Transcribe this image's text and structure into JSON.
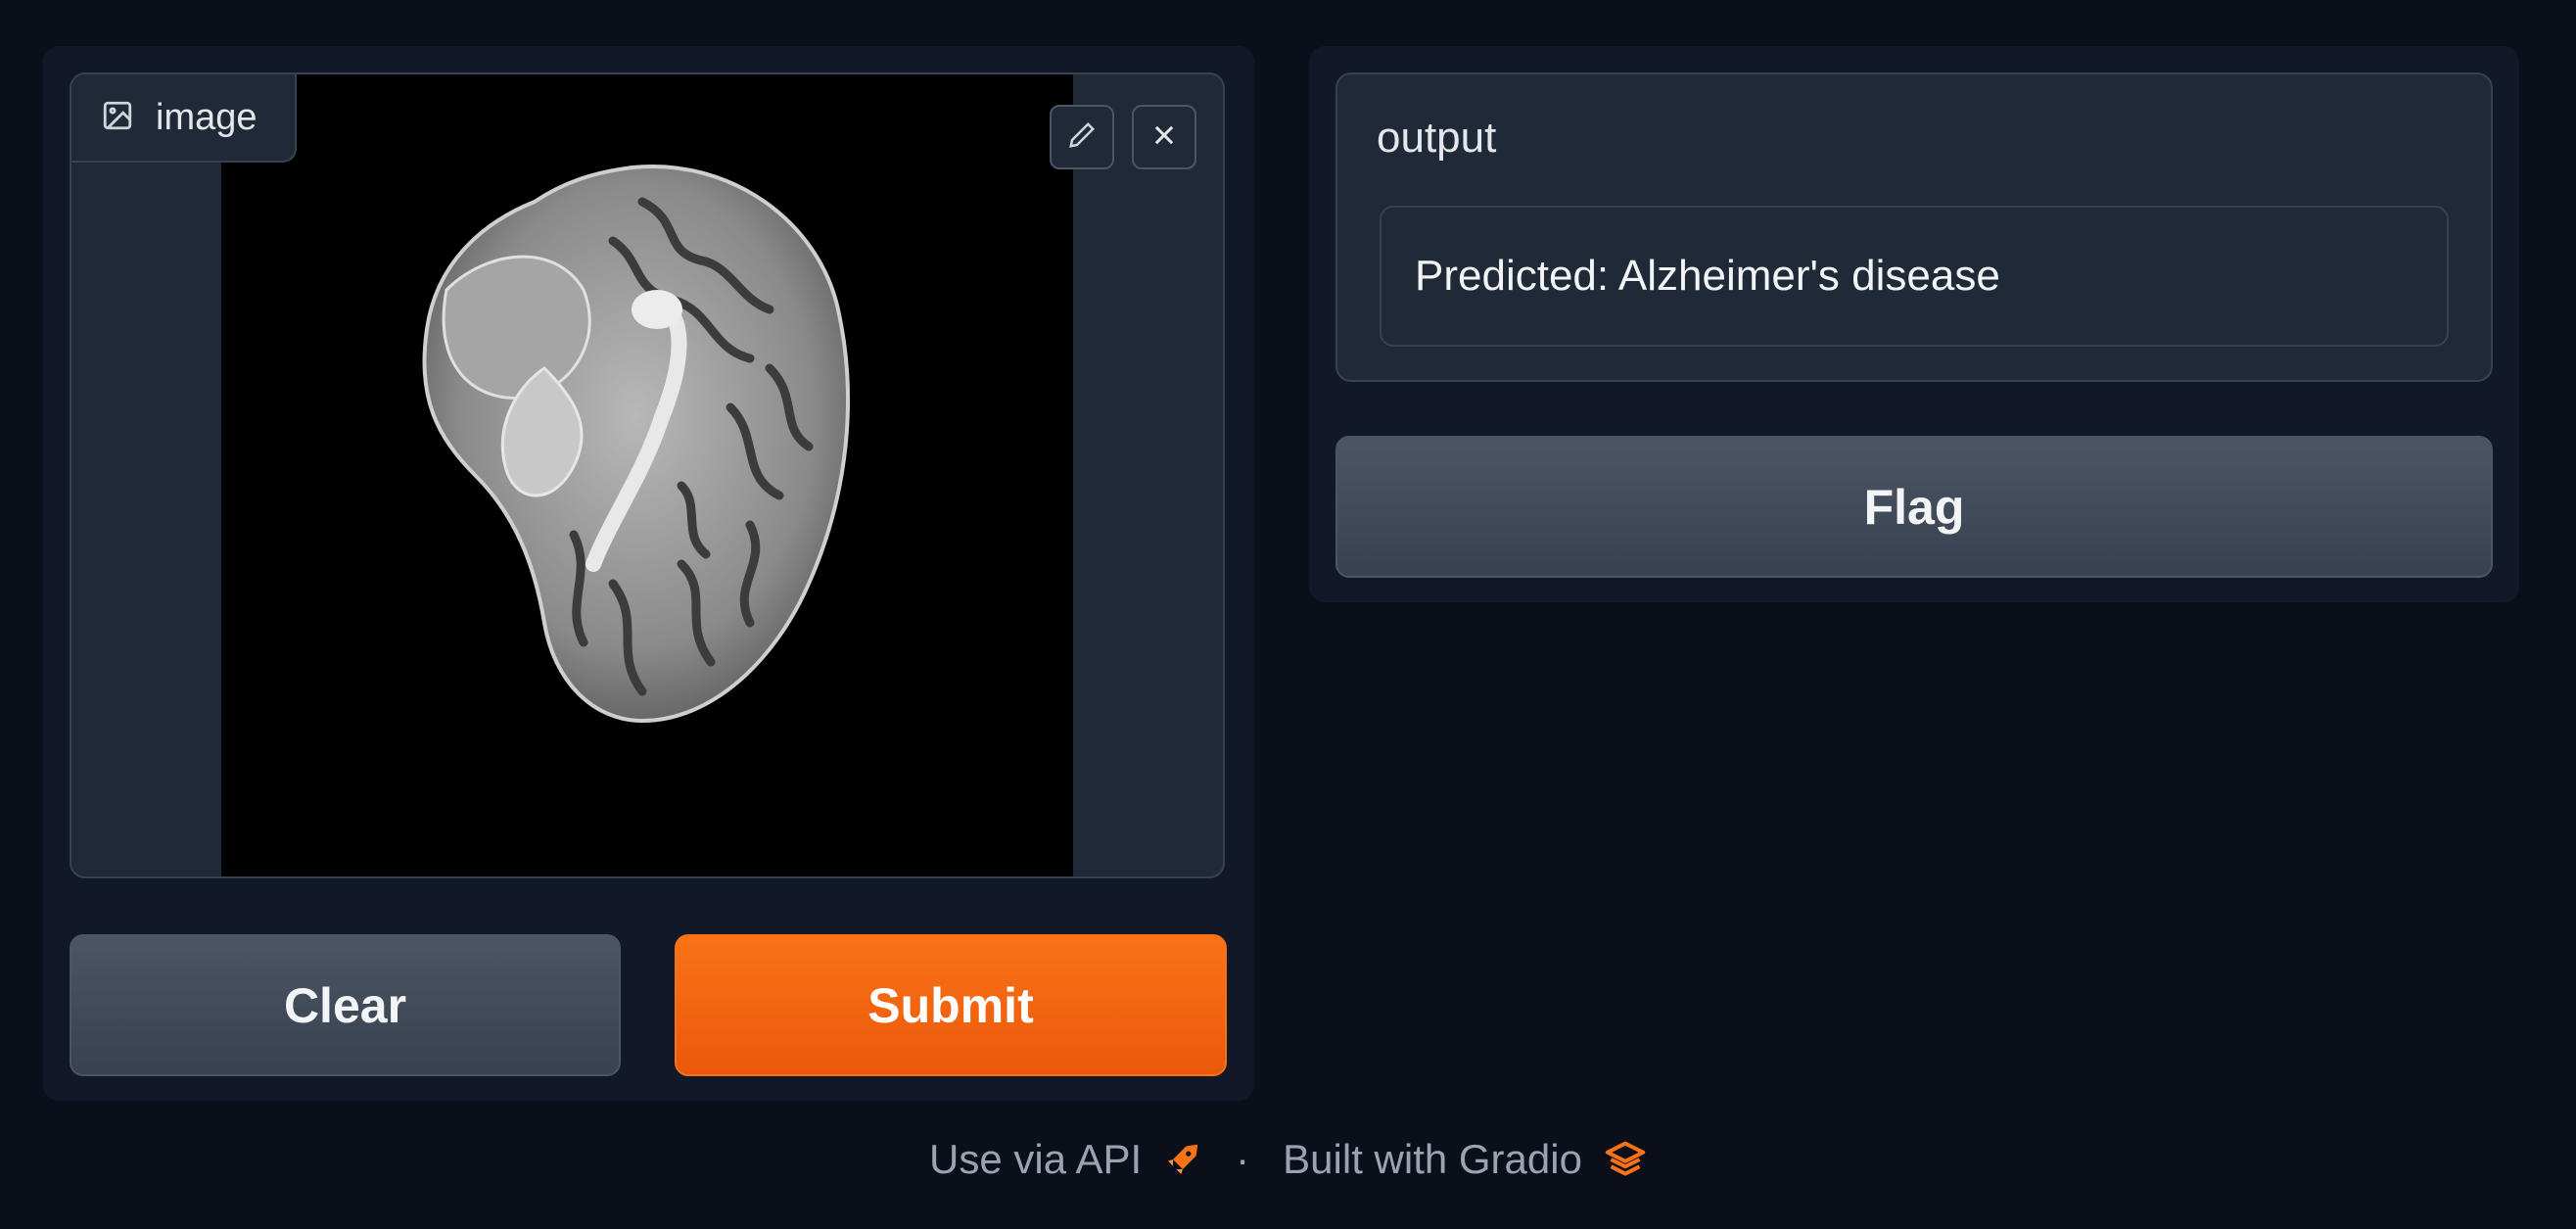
{
  "input": {
    "image_label": "image",
    "image_icon": "image-icon",
    "edit_icon": "pencil-icon",
    "close_icon": "close-icon"
  },
  "buttons": {
    "clear_label": "Clear",
    "submit_label": "Submit",
    "flag_label": "Flag"
  },
  "output": {
    "label": "output",
    "value": "Predicted: Alzheimer's disease"
  },
  "footer": {
    "api_label": "Use via API",
    "api_icon": "rocket-icon",
    "separator": "·",
    "built_label": "Built with Gradio",
    "gradio_icon": "gradio-logo-icon"
  },
  "colors": {
    "background": "#0b0f19",
    "panel": "#111827",
    "block": "#1f2937",
    "accent": "#f97316",
    "secondary_button": "#4b5563"
  }
}
